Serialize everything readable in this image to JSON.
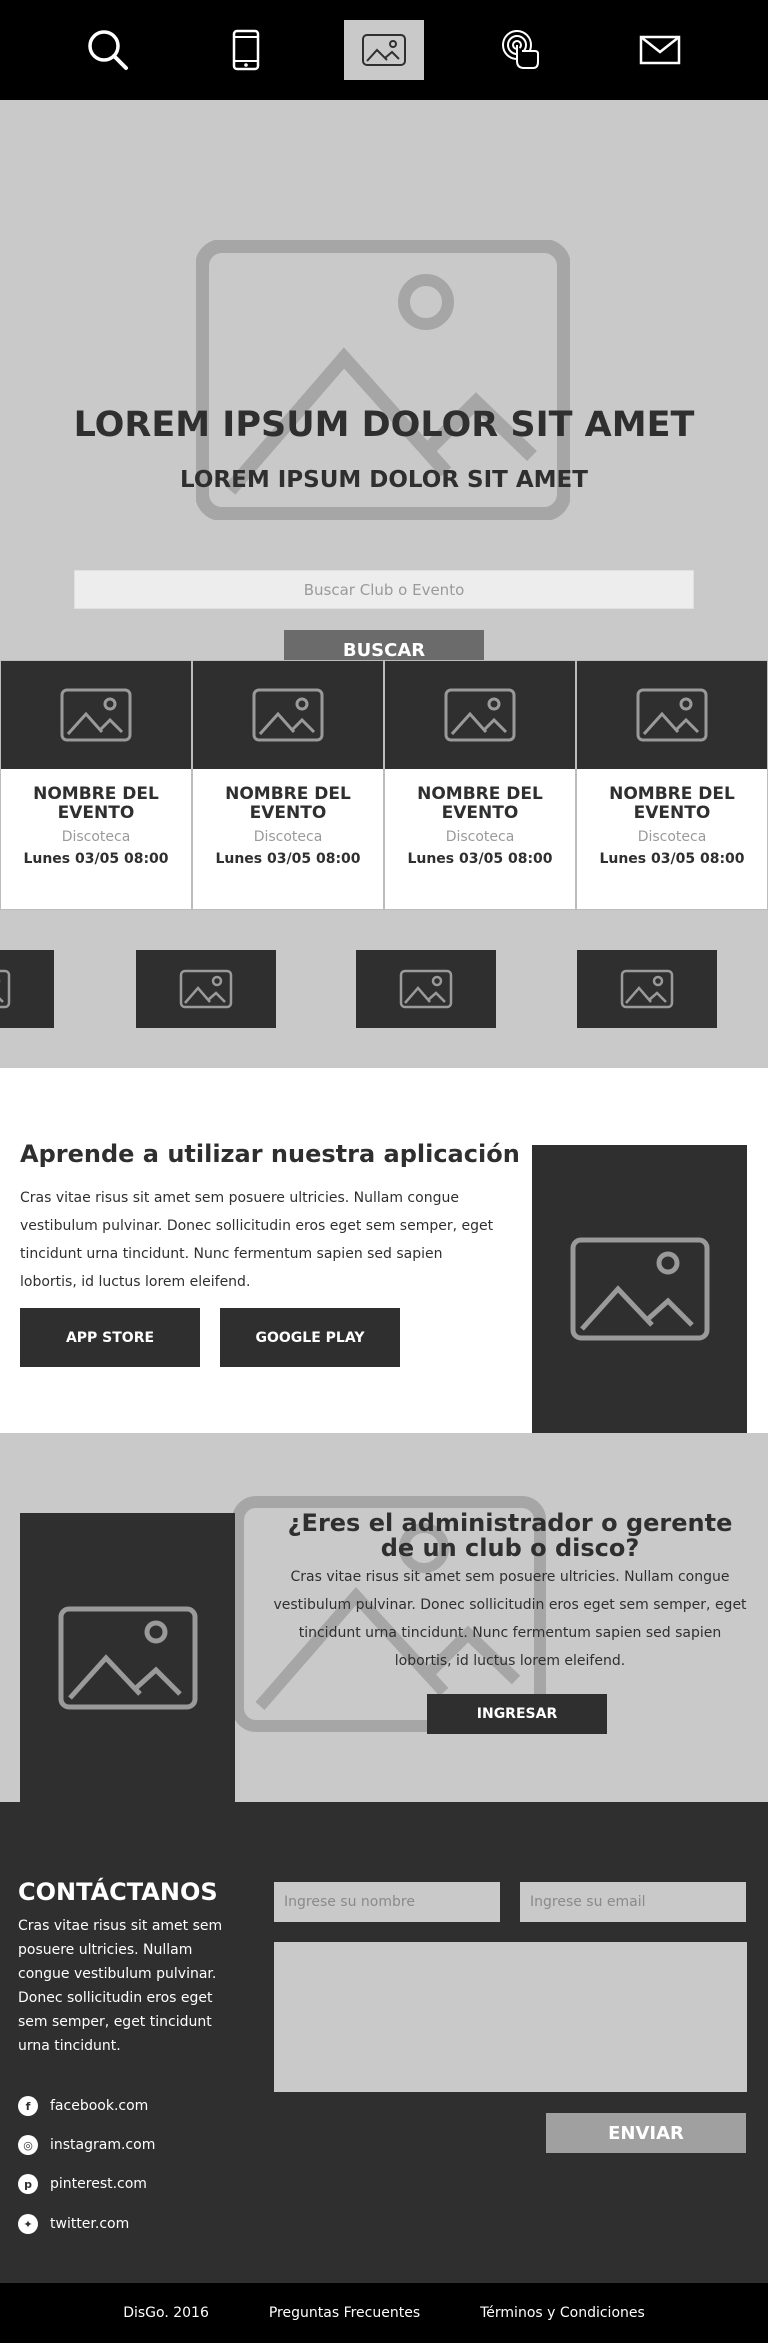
{
  "nav": {
    "items": [
      {
        "icon": "search-icon"
      },
      {
        "icon": "smartphone-icon"
      },
      {
        "icon": "image-icon",
        "active": true
      },
      {
        "icon": "touch-icon"
      },
      {
        "icon": "mail-icon"
      }
    ]
  },
  "hero": {
    "title": "LOREM IPSUM DOLOR SIT AMET",
    "subtitle": "LOREM IPSUM DOLOR SIT AMET",
    "search_placeholder": "Buscar Club o Evento",
    "search_button": "BUSCAR"
  },
  "events": [
    {
      "name": "NOMBRE DEL EVENTO",
      "type": "Discoteca",
      "date": "Lunes 03/05 08:00"
    },
    {
      "name": "NOMBRE DEL EVENTO",
      "type": "Discoteca",
      "date": "Lunes 03/05 08:00"
    },
    {
      "name": "NOMBRE DEL EVENTO",
      "type": "Discoteca",
      "date": "Lunes 03/05 08:00"
    },
    {
      "name": "NOMBRE DEL EVENTO",
      "type": "Discoteca",
      "date": "Lunes 03/05 08:00"
    }
  ],
  "app": {
    "title": "Aprende a utilizar nuestra aplicación",
    "text": "Cras vitae risus sit amet sem posuere ultricies. Nullam congue vestibulum pulvinar. Donec sollicitudin eros eget sem semper, eget tincidunt urna tincidunt. Nunc fermentum sapien sed sapien lobortis, id luctus lorem eleifend.",
    "app_store": "APP STORE",
    "google_play": "GOOGLE PLAY"
  },
  "admin": {
    "title": "¿Eres el administrador o gerente de un club o disco?",
    "text": "Cras vitae risus sit amet sem posuere ultricies. Nullam congue vestibulum pulvinar. Donec sollicitudin eros eget sem semper, eget tincidunt urna tincidunt. Nunc fermentum sapien sed sapien lobortis, id luctus lorem eleifend.",
    "button": "INGRESAR"
  },
  "contact": {
    "title": "CONTÁCTANOS",
    "text": "Cras vitae risus sit amet sem posuere ultricies. Nullam congue vestibulum pulvinar. Donec sollicitudin eros eget sem semper, eget tincidunt urna tincidunt.",
    "name_placeholder": "Ingrese su nombre",
    "email_placeholder": "Ingrese su email",
    "submit": "ENVIAR",
    "socials": [
      {
        "icon": "facebook-icon",
        "glyph": "f",
        "label": "facebook.com"
      },
      {
        "icon": "instagram-icon",
        "glyph": "◎",
        "label": "instagram.com"
      },
      {
        "icon": "pinterest-icon",
        "glyph": "p",
        "label": "pinterest.com"
      },
      {
        "icon": "twitter-icon",
        "glyph": "✦",
        "label": "twitter.com"
      }
    ]
  },
  "footer": {
    "links": [
      "DisGo. 2016",
      "Preguntas Frecuentes",
      "Términos y Condiciones"
    ]
  },
  "colors": {
    "dark": "#2f2f2f",
    "light_gray": "#c9c9c9",
    "black": "#000000",
    "button_gray": "#6b6b6b"
  }
}
